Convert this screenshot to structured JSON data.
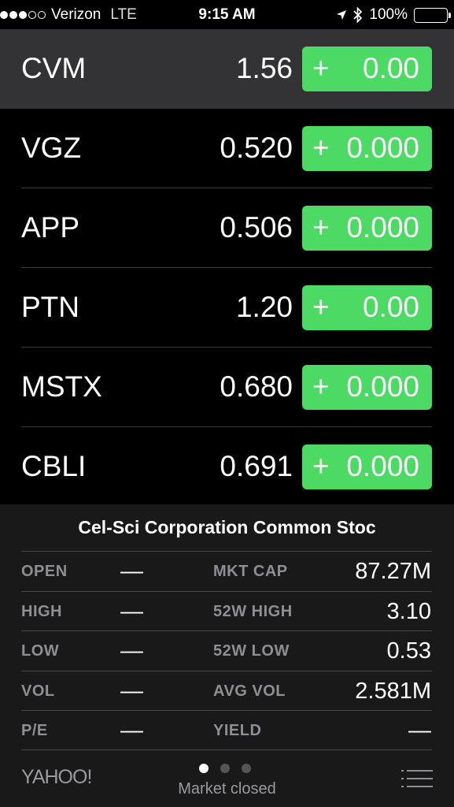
{
  "status_bar": {
    "carrier": "Verizon",
    "network": "LTE",
    "time": "9:15 AM",
    "battery": "100%",
    "signal_strength": 3
  },
  "stocks": [
    {
      "symbol": "CVM",
      "price": "1.56",
      "sign": "+",
      "change": "0.00",
      "selected": true
    },
    {
      "symbol": "VGZ",
      "price": "0.520",
      "sign": "+",
      "change": "0.000"
    },
    {
      "symbol": "APP",
      "price": "0.506",
      "sign": "+",
      "change": "0.000"
    },
    {
      "symbol": "PTN",
      "price": "1.20",
      "sign": "+",
      "change": "0.00"
    },
    {
      "symbol": "MSTX",
      "price": "0.680",
      "sign": "+",
      "change": "0.000"
    },
    {
      "symbol": "CBLI",
      "price": "0.691",
      "sign": "+",
      "change": "0.000"
    }
  ],
  "detail": {
    "company_name": "Cel-Sci Corporation Common Stoc",
    "stats": [
      {
        "label1": "OPEN",
        "value1": "—",
        "label2": "MKT CAP",
        "value2": "87.27M"
      },
      {
        "label1": "HIGH",
        "value1": "—",
        "label2": "52W HIGH",
        "value2": "3.10"
      },
      {
        "label1": "LOW",
        "value1": "—",
        "label2": "52W LOW",
        "value2": "0.53"
      },
      {
        "label1": "VOL",
        "value1": "—",
        "label2": "AVG VOL",
        "value2": "2.581M"
      },
      {
        "label1": "P/E",
        "value1": "—",
        "label2": "YIELD",
        "value2": "—"
      }
    ]
  },
  "footer": {
    "logo": "YAHOO!",
    "market_status": "Market closed",
    "page_count": 3,
    "active_page": 0
  },
  "colors": {
    "change_positive": "#4cd964",
    "selected_row": "#333335",
    "panel_bg": "#19191a"
  }
}
